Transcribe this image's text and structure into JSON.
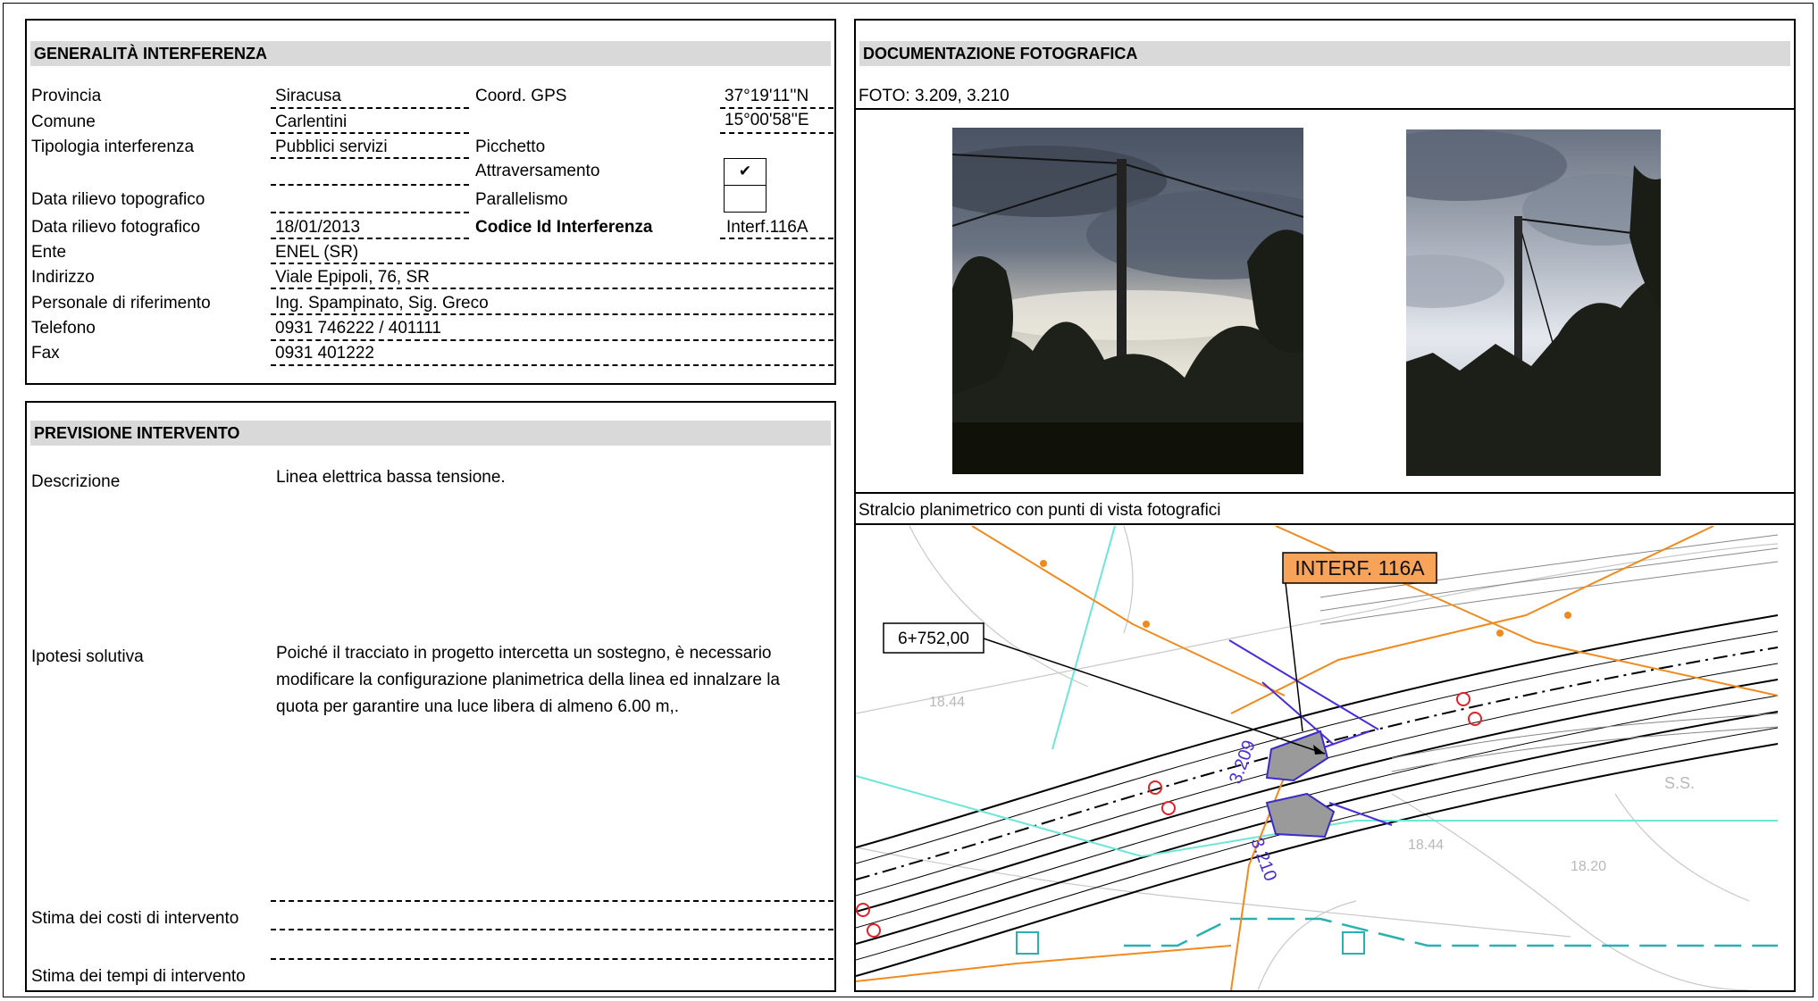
{
  "generalita": {
    "title": "GENERALITÀ  INTERFERENZA",
    "provincia_label": "Provincia",
    "provincia_value": "Siracusa",
    "comune_label": "Comune",
    "comune_value": "Carlentini",
    "tipologia_label": "Tipologia interferenza",
    "tipologia_value": "Pubblici servizi",
    "topo_label": "Data rilievo topografico",
    "foto_label": "Data rilievo fotografico",
    "foto_value": "18/01/2013",
    "ente_label": "Ente",
    "ente_value": "ENEL (SR)",
    "indirizzo_label": "Indirizzo",
    "indirizzo_value": "Viale Epipoli, 76, SR",
    "personale_label": "Personale di riferimento",
    "personale_value": "Ing. Spampinato, Sig. Greco",
    "telefono_label": "Telefono",
    "telefono_value": "0931 746222 / 401111",
    "fax_label": "Fax",
    "fax_value": "0931 401222",
    "coord_label": "Coord. GPS",
    "coord_lat": "37°19'11''N",
    "coord_lon": "15°00'58''E",
    "picchetto_label": "Picchetto",
    "attraversamento_label": "Attraversamento",
    "attraversamento_mark": "✔",
    "parallelismo_label": "Parallelismo",
    "codice_label": "Codice Id Interferenza",
    "codice_value": "Interf.116A"
  },
  "previsione": {
    "title": "PREVISIONE INTERVENTO",
    "descrizione_label": "Descrizione",
    "descrizione_value": "Linea elettrica bassa tensione.",
    "ipotesi_label": "Ipotesi solutiva",
    "ipotesi_value": "Poiché il tracciato in progetto intercetta un sostegno, è necessario modificare la configurazione planimetrica della linea ed innalzare la quota per garantire una luce libera di almeno 6.00 m,.",
    "costi_label": "Stima dei costi di intervento",
    "tempi_label": "Stima dei tempi di intervento"
  },
  "documentazione": {
    "title": "DOCUMENTAZIONE FOTOGRAFICA",
    "foto_caption": "FOTO: 3.209, 3.210",
    "stralcio_caption": "Stralcio planimetrico con punti di vista fotografici"
  },
  "map": {
    "interf_label": "INTERF. 116A",
    "progressiva_label": "6+752,00",
    "view1_label": "3.209",
    "view2_label": "3.210",
    "elev1": "18.44",
    "elev2": "18.44",
    "elev3": "18.20",
    "ss_label": "S.S."
  }
}
